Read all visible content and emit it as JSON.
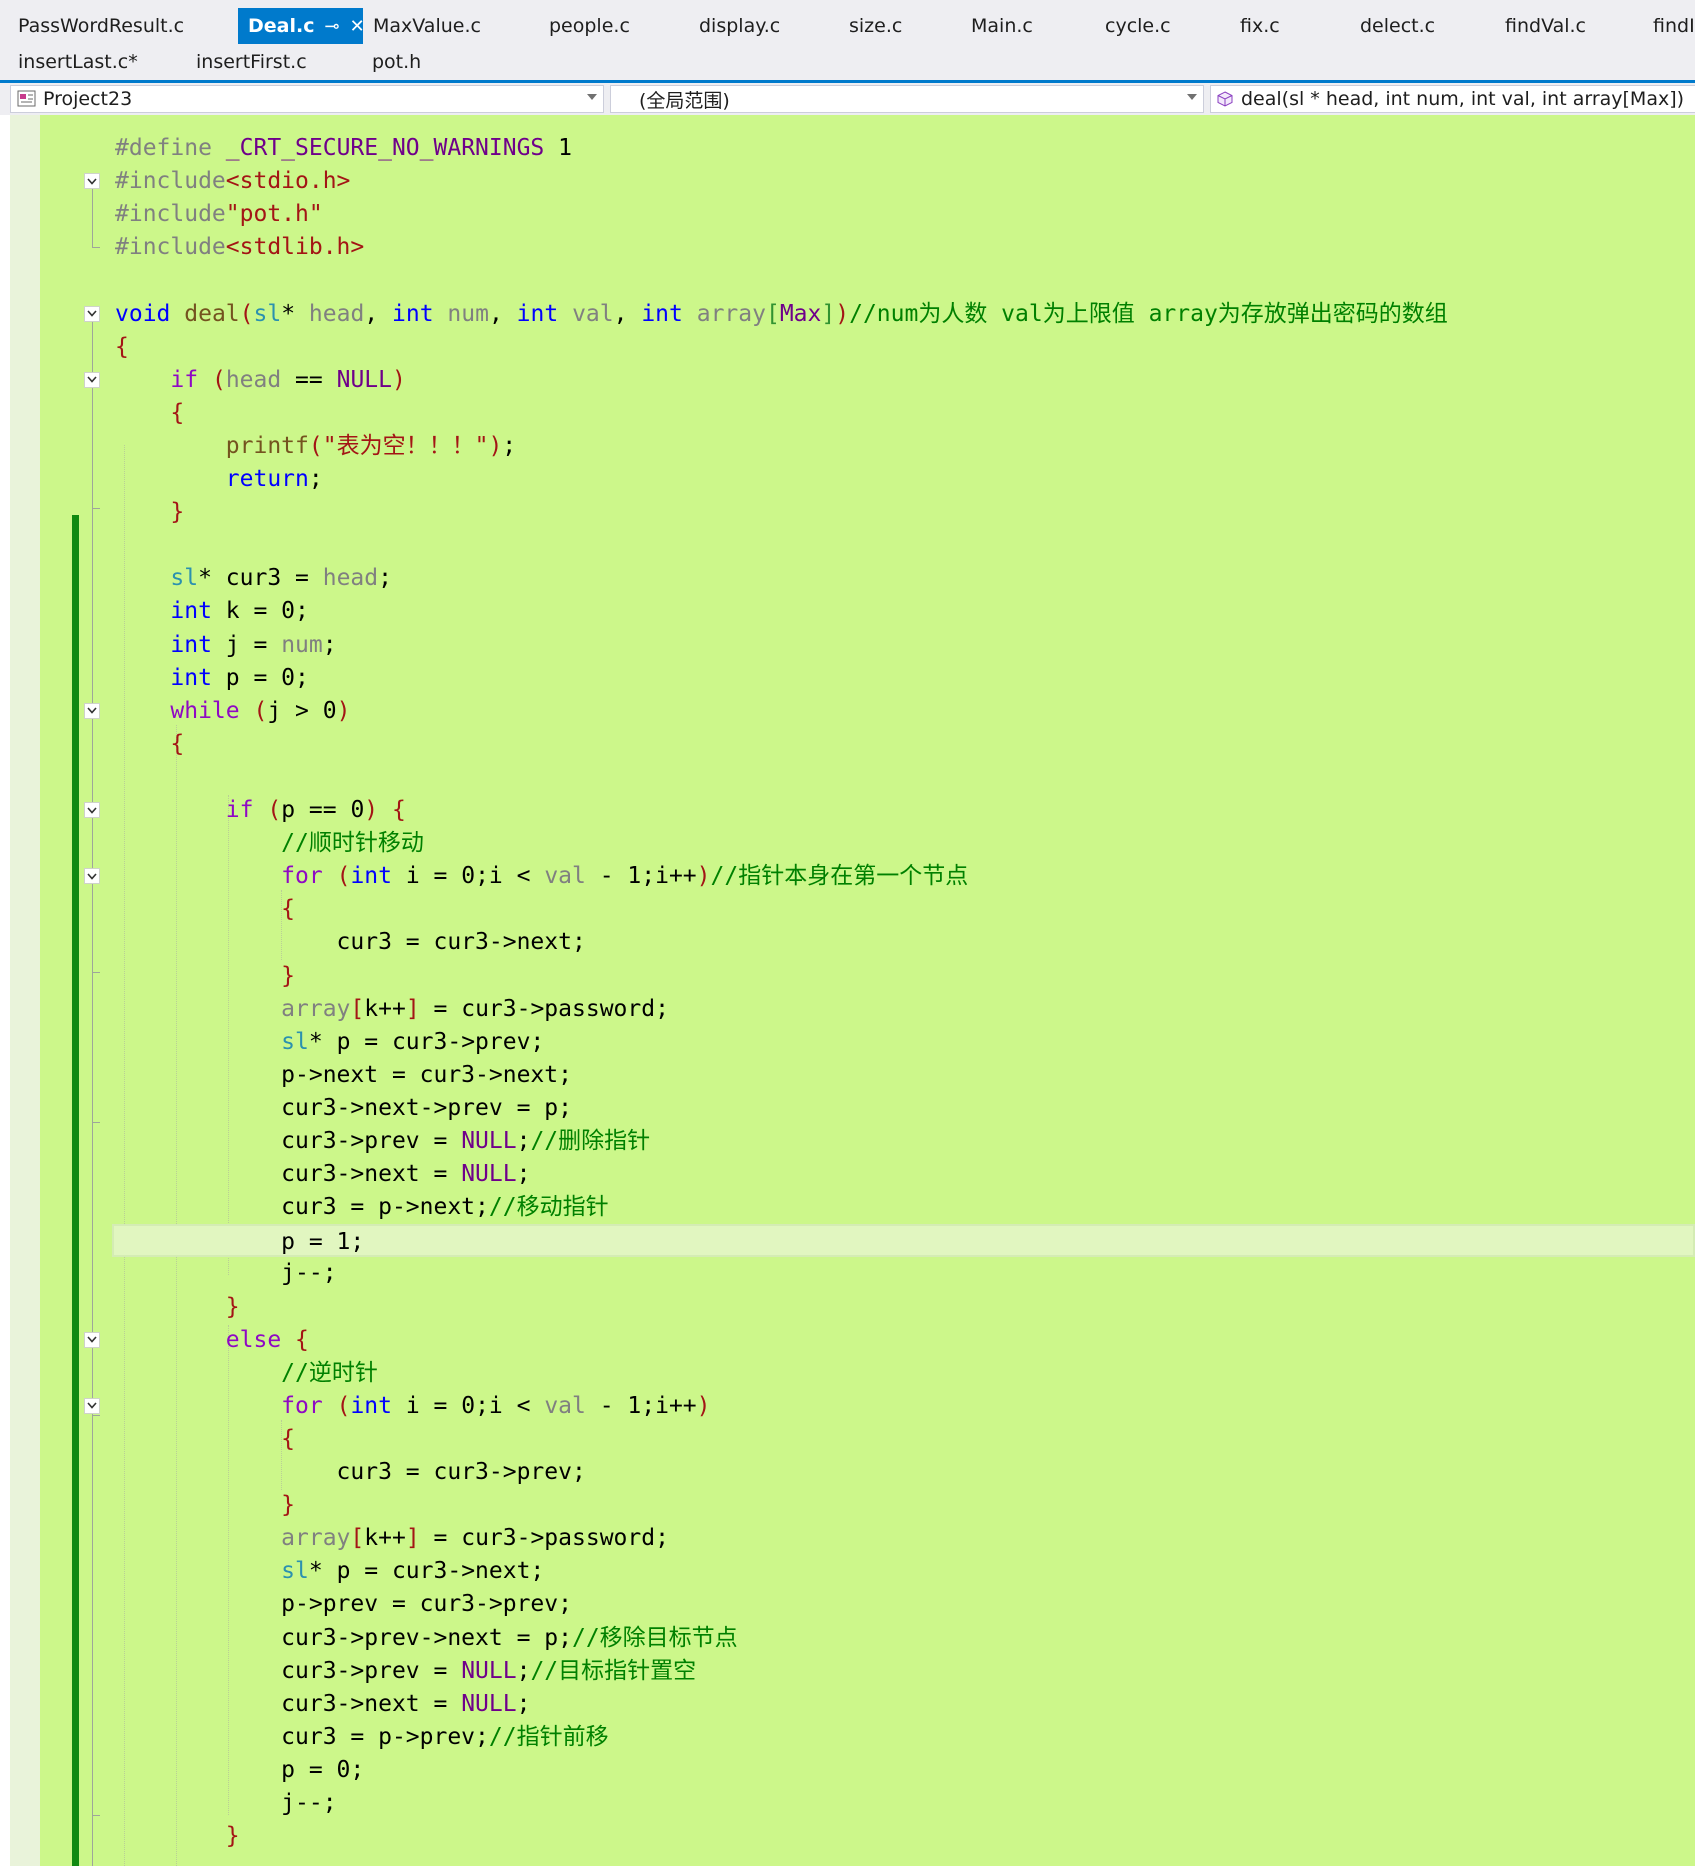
{
  "tabs_row1": [
    {
      "label": "PassWordResult.c",
      "active": false,
      "width": 238
    },
    {
      "label": "Deal.c",
      "active": true,
      "width": 125
    },
    {
      "label": "MaxValue.c",
      "active": false,
      "width": 176
    },
    {
      "label": "people.c",
      "active": false,
      "width": 150
    },
    {
      "label": "display.c",
      "active": false,
      "width": 150
    },
    {
      "label": "size.c",
      "active": false,
      "width": 122
    },
    {
      "label": "Main.c",
      "active": false,
      "width": 134
    },
    {
      "label": "cycle.c",
      "active": false,
      "width": 135
    },
    {
      "label": "fix.c",
      "active": false,
      "width": 120
    },
    {
      "label": "delect.c",
      "active": false,
      "width": 145
    },
    {
      "label": "findVal.c",
      "active": false,
      "width": 148
    },
    {
      "label": "findIn",
      "active": false,
      "width": 80
    }
  ],
  "tabs_row2": [
    {
      "label": "insertLast.c*",
      "width": 178
    },
    {
      "label": "insertFirst.c",
      "width": 176
    },
    {
      "label": "pot.h",
      "width": 132
    }
  ],
  "active_tab_pin": "⊸",
  "active_tab_close": "✕",
  "navbar": {
    "project": "Project23",
    "scope": "(全局范围)",
    "member": "deal(sl * head, int num, int val, int array[Max])"
  },
  "code_lines": [
    "#define _CRT_SECURE_NO_WARNINGS 1",
    "#include<stdio.h>",
    "#include\"pot.h\"",
    "#include<stdlib.h>",
    "",
    "void deal(sl* head, int num, int val, int array[Max])//num为人数 val为上限值 array为存放弹出密码的数组",
    "{",
    "    if (head == NULL)",
    "    {",
    "        printf(\"表为空！！！\");",
    "        return;",
    "    }",
    "",
    "    sl* cur3 = head;",
    "    int k = 0;",
    "    int j = num;",
    "    int p = 0;",
    "    while (j > 0)",
    "    {",
    "",
    "        if (p == 0) {",
    "            //顺时针移动",
    "            for (int i = 0;i < val - 1;i++)//指针本身在第一个节点",
    "            {",
    "                cur3 = cur3->next;",
    "            }",
    "            array[k++] = cur3->password;",
    "            sl* p = cur3->prev;",
    "            p->next = cur3->next;",
    "            cur3->next->prev = p;",
    "            cur3->prev = NULL;//删除指针",
    "            cur3->next = NULL;",
    "            cur3 = p->next;//移动指针",
    "            p = 1;",
    "            j--;",
    "        }",
    "        else {",
    "            //逆时针",
    "            for (int i = 0;i < val - 1;i++)",
    "            {",
    "                cur3 = cur3->prev;",
    "            }",
    "            array[k++] = cur3->password;",
    "            sl* p = cur3->next;",
    "            p->prev = cur3->prev;",
    "            cur3->prev->next = p;//移除目标节点",
    "            cur3->prev = NULL;//目标指针置空",
    "            cur3->next = NULL;",
    "            cur3 = p->prev;//指针前移",
    "            p = 0;",
    "            j--;",
    "        }"
  ]
}
